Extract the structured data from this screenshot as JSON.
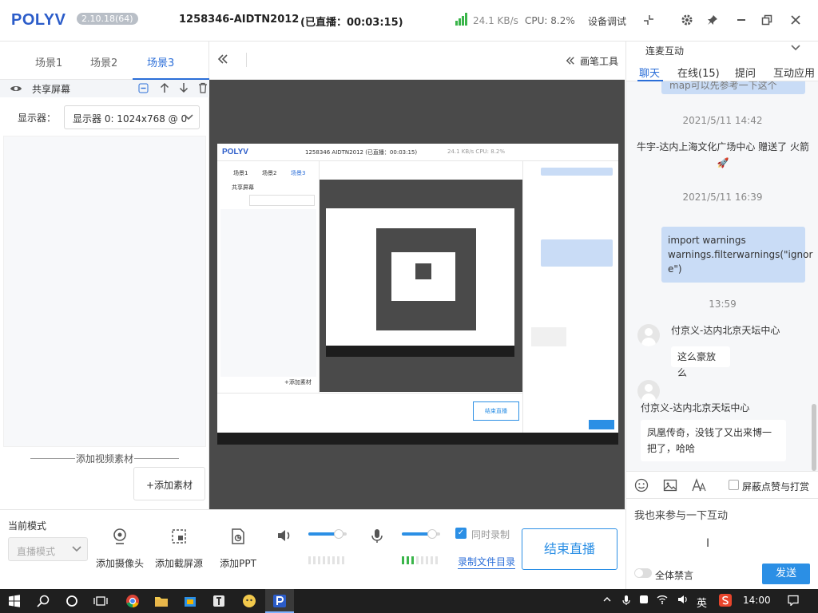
{
  "titlebar": {
    "logo": "POLYV",
    "version": "2.10.18(64)",
    "live_title": "1258346-AIDTN2012",
    "live_status": "(已直播：00:03:15)",
    "net_speed": "24.1 KB/s",
    "cpu": "CPU: 8.2%",
    "device_debug": "设备调试",
    "icons": [
      "shrink-icon",
      "gear-icon",
      "pin-icon",
      "minimize-icon",
      "restore-icon",
      "close-icon"
    ]
  },
  "scenes": {
    "tabs": [
      "场景1",
      "场景2",
      "场景3"
    ],
    "active_tab": "场景3",
    "source_name": "共享屏幕",
    "display_label": "显示器：",
    "display_value": "显示器 0: 1024x768 @ 0",
    "add_video_label": "添加视频素材",
    "add_material": "+添加素材"
  },
  "center": {
    "pen_tools": "画笔工具",
    "preview_title": "1258346  AIDTN2012   (已直播：00:03:15)",
    "preview_speed": "24.1 KB/s   CPU: 8.2%",
    "preview_tabs": [
      "场景1",
      "场景2",
      "场景3"
    ],
    "preview_end": "结束直播",
    "preview_add": "+添加素材"
  },
  "bottom": {
    "mode_label": "当前模式",
    "mode_value": "直播模式",
    "tools": [
      {
        "label": "添加摄像头",
        "icon": "camera-icon"
      },
      {
        "label": "添加截屏源",
        "icon": "screenshot-icon"
      },
      {
        "label": "添加PPT",
        "icon": "ppt-icon"
      }
    ],
    "speaker_volume": 0.8,
    "mic_volume": 0.8,
    "speaker_meter_on": 0,
    "mic_meter_on": 3,
    "sync_record": "同时录制",
    "sync_checked": true,
    "record_dir": "录制文件目录",
    "end_live": "结束直播"
  },
  "chat": {
    "section_title": "连麦互动",
    "tabs": [
      "聊天",
      "在线(15)",
      "提问",
      "互动应用"
    ],
    "active_tab": "聊天",
    "partial_bubble": "map可以先参考一下这个",
    "time1": "2021/5/11 14:42",
    "sys_msg": "牛宇-达内上海文化广场中心 赠送了 火箭",
    "rocket": "🚀",
    "time2": "2021/5/11 16:39",
    "code_lines": [
      "import warnings",
      "warnings.filterwarnings(\"ignor",
      "e\")"
    ],
    "time3": "13:59",
    "msg1_nick": "付京义-达内北京天坛中心",
    "msg1_text": "这么豪放么",
    "msg2_nick": "付京义-达内北京天坛中心",
    "msg2_lines": [
      "凤凰传奇，没钱了又出来博一",
      "把了，哈哈"
    ],
    "toolbar_icons": [
      "emoji-icon",
      "image-icon",
      "font-icon"
    ],
    "shield_label": "屏蔽点赞与打赏",
    "input_value": "我也来参与一下互动",
    "mute_all": "全体禁言",
    "send": "发送"
  },
  "taskbar": {
    "ime": "英",
    "clock": "14:00"
  }
}
